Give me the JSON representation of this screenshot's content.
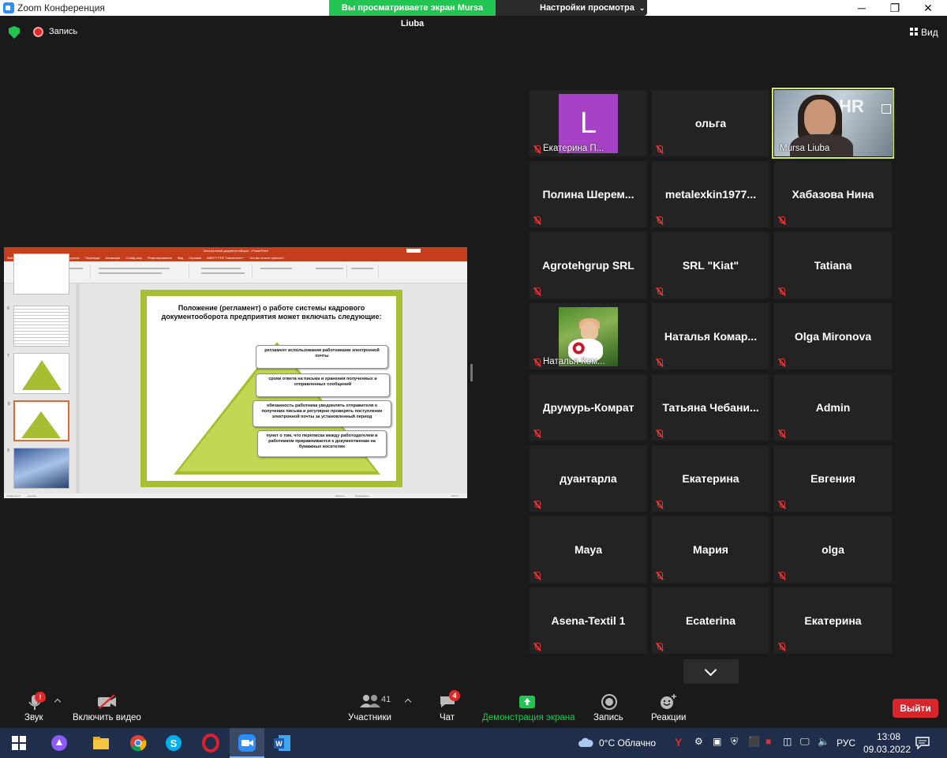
{
  "window": {
    "title": "Zoom Конференция",
    "share_banner": "Вы просматриваете экран Mursa Liuba",
    "view_options": "Настройки просмотра",
    "minimize": "─",
    "maximize": "❐",
    "close": "✕"
  },
  "top": {
    "record_label": "Запись",
    "view_label": "Вид"
  },
  "shared_screen": {
    "app_title": "Электронный документооборот - PowerPoint",
    "ribbon_tabs": [
      "Файл",
      "Главная",
      "Вставка",
      "Конструктор",
      "Переходы",
      "Анимация",
      "Слайд-шоу",
      "Рецензирование",
      "Вид",
      "Справка",
      "ABBYY PDF Transformer+",
      "Что вы хотите сделать?"
    ],
    "active_tab": "Главная",
    "slide_title": "Положение (регламент) о работе системы кадрового документооборота предприятия может включать следующие:",
    "boxes": [
      "регламент использования работниками электронной почты",
      "сроки ответа на письма и хранения полученных и отправленных сообщений",
      "обязанность работника уведомлять отправителя о получении письма и регулярно проверять поступление электронной почты за установленный период",
      "пункт о том, что переписка между работодателем и работником приравнивается к документменам на бумажных носителях"
    ],
    "thumb_numbers": [
      "6",
      "7",
      "8",
      "9"
    ],
    "status_left": "Слайд 8 из 9",
    "status_lang": "русский",
    "status_notes": "Заметки",
    "status_comments": "Примечания",
    "zoom_level": "116 %"
  },
  "participants": [
    {
      "name": "Екатерина П...",
      "display": "avatar-letter",
      "letter": "L",
      "muted": true
    },
    {
      "name": "ольга",
      "display": "name",
      "muted": true
    },
    {
      "name": "Mursa Liuba",
      "display": "video",
      "muted": false,
      "active_speaker": true
    },
    {
      "name": "Полина  Шерем...",
      "display": "name",
      "muted": true
    },
    {
      "name": "metalexkin1977...",
      "display": "name",
      "muted": true
    },
    {
      "name": "Хабазова Нина",
      "display": "name",
      "muted": true
    },
    {
      "name": "Agrotehgrup SRL",
      "display": "name",
      "muted": true
    },
    {
      "name": "SRL \"Kiat\"",
      "display": "name",
      "muted": true
    },
    {
      "name": "Tatiana",
      "display": "name",
      "muted": true
    },
    {
      "name": "Наталья Ком...",
      "display": "photo",
      "muted": true
    },
    {
      "name": "Наталья  Комар...",
      "display": "name",
      "muted": true
    },
    {
      "name": "Olga Mironova",
      "display": "name",
      "muted": true
    },
    {
      "name": "Друмурь-Комрат",
      "display": "name",
      "muted": true
    },
    {
      "name": "Татьяна  Чебани...",
      "display": "name",
      "muted": true
    },
    {
      "name": "Admin",
      "display": "name",
      "muted": true
    },
    {
      "name": "дуантарла",
      "display": "name",
      "muted": true
    },
    {
      "name": "Екатерина",
      "display": "name",
      "muted": true
    },
    {
      "name": "Евгения",
      "display": "name",
      "muted": true
    },
    {
      "name": "Maya",
      "display": "name",
      "muted": true
    },
    {
      "name": "Мария",
      "display": "name",
      "muted": true
    },
    {
      "name": "olga",
      "display": "name",
      "muted": true
    },
    {
      "name": "Asena-Textil 1",
      "display": "name",
      "muted": true
    },
    {
      "name": "Ecaterina",
      "display": "name",
      "muted": true
    },
    {
      "name": "Екатерина",
      "display": "name",
      "muted": true
    }
  ],
  "toolbar": {
    "audio_label": "Звук",
    "audio_badge": "!",
    "video_label": "Включить видео",
    "participants_label": "Участники",
    "participants_count": "41",
    "chat_label": "Чат",
    "chat_badge": "4",
    "share_label": "Демонстрация экрана",
    "record_label": "Запись",
    "reactions_label": "Реакции",
    "leave_label": "Выйти"
  },
  "taskbar": {
    "weather": "0°C  Облачно",
    "language": "РУС",
    "time": "13:08",
    "date": "09.03.2022"
  },
  "colors": {
    "zoom_green": "#23c552",
    "ppt_red": "#c43e1c",
    "slide_green": "#a7be33",
    "active_speaker_outline": "#d2ec5a",
    "leave_red": "#d8262c"
  }
}
